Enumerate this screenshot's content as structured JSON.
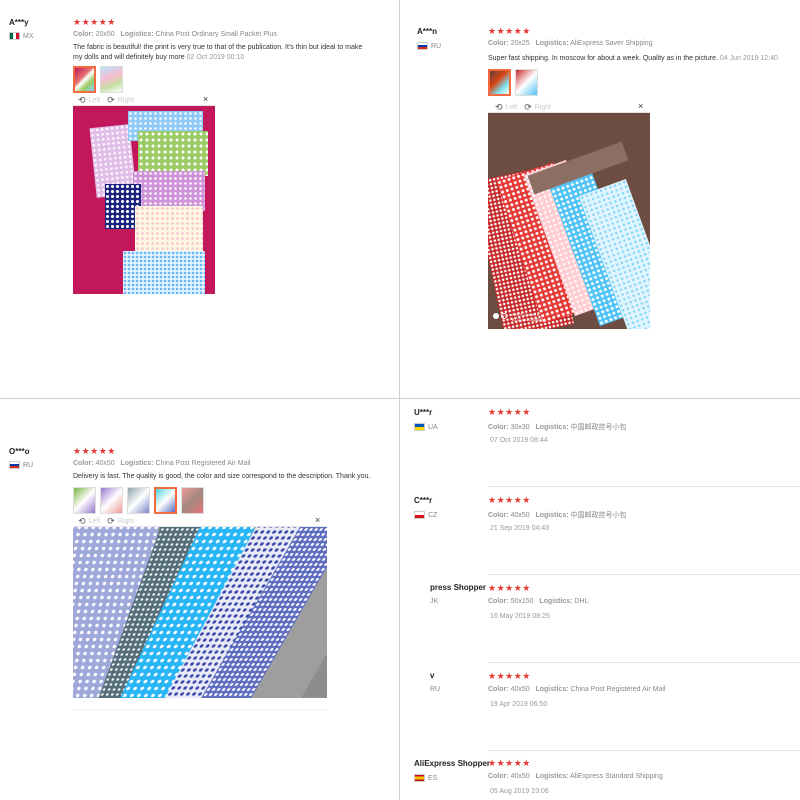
{
  "reviews": {
    "tl": {
      "name": "A***y",
      "country": "MX",
      "stars": "★★★★★",
      "color_label": "Color:",
      "color": "20x50",
      "logistics_label": "Logistics:",
      "logistics": "China Post Ordinary Small Packet Plus",
      "text": "The fabric is beautiful! the print is very true to that of the publication. It's thin but ideal to make my dolls and will definitely buy more",
      "date": "02 Oct 2019 00:10",
      "left_label": "Left",
      "right_label": "Right",
      "close": "×"
    },
    "tr": {
      "name": "A***n",
      "country": "RU",
      "stars": "★★★★★",
      "color_label": "Color:",
      "color": "20x25",
      "logistics_label": "Logistics:",
      "logistics": "AliExpress Saver Shipping",
      "text": "Super fast shipping. In moscow for about a week. Quality as in the picture.",
      "date": "04 Jun 2019 12:40",
      "left_label": "Left",
      "right_label": "Right",
      "close": "×",
      "watermark_1": "SHOT ON MI 8",
      "watermark_2": "AI DUAL CAMERA"
    },
    "bl": {
      "name": "O***o",
      "country": "RU",
      "stars": "★★★★★",
      "color_label": "Color:",
      "color": "40x50",
      "logistics_label": "Logistics:",
      "logistics": "China Post Registered Air Mail",
      "text": "Delivery is fast. The quality is good, the color and size correspond to the description. Thank you.",
      "date": "",
      "left_label": "Left",
      "right_label": "Right",
      "close": "×"
    }
  },
  "list": [
    {
      "name": "U***r",
      "country": "UA",
      "stars": "★★★★★",
      "color_label": "Color:",
      "color": "30x30",
      "logistics_label": "Logistics:",
      "logistics": "中国邮政挂号小包",
      "date": "07 Oct 2019 08:44"
    },
    {
      "name": "C***r",
      "country": "CZ",
      "stars": "★★★★★",
      "color_label": "Color:",
      "color": "40x50",
      "logistics_label": "Logistics:",
      "logistics": "中国邮政挂号小包",
      "date": "21 Sep 2019 04:43"
    },
    {
      "name": "press Shopper",
      "country": "JK",
      "stars": "★★★★★",
      "color_label": "Color:",
      "color": "50x150",
      "logistics_label": "Logistics:",
      "logistics": "DHL",
      "date": "16 May 2019 08:25"
    },
    {
      "name": "v",
      "country": "RU",
      "stars": "★★★★★",
      "color_label": "Color:",
      "color": "40x50",
      "logistics_label": "Logistics:",
      "logistics": "China Post Registered Air Mail",
      "date": "19 Apr 2019 06:50"
    },
    {
      "name": "AliExpress Shopper",
      "country": "ES",
      "stars": "★★★★★",
      "color_label": "Color:",
      "color": "40x50",
      "logistics_label": "Logistics:",
      "logistics": "AliExpress Standard Shipping",
      "date": "05 Aug 2019 23:06"
    }
  ],
  "colors": {
    "star": "#e53935",
    "accent": "#f26a3d"
  },
  "icons": {
    "rotate_left": "rotate-left-icon",
    "rotate_right": "rotate-right-icon",
    "close": "close-icon"
  }
}
